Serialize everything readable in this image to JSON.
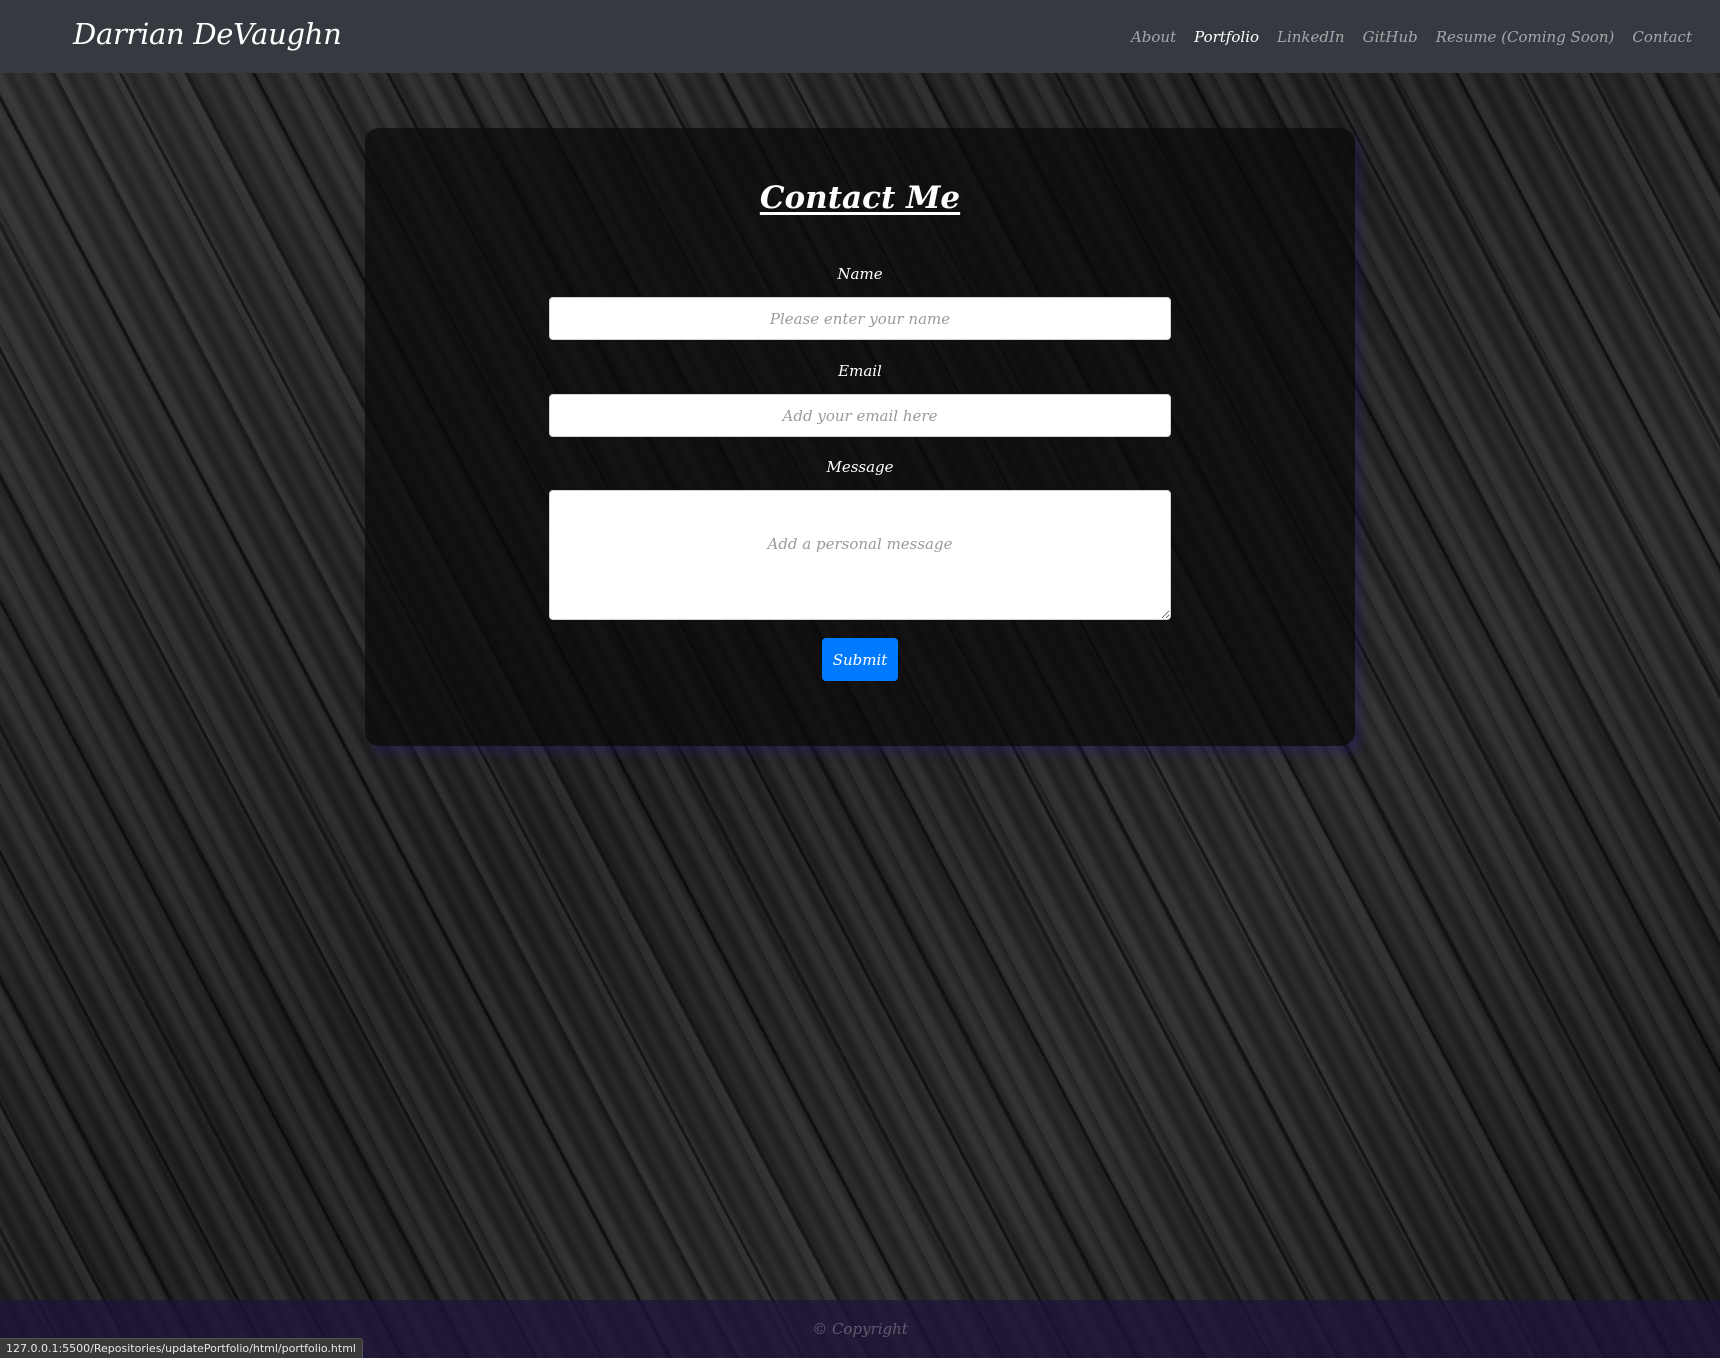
{
  "navbar": {
    "brand": "Darrian DeVaughn",
    "links": [
      {
        "label": "About",
        "active": false
      },
      {
        "label": "Portfolio",
        "active": true
      },
      {
        "label": "LinkedIn",
        "active": false
      },
      {
        "label": "GitHub",
        "active": false
      },
      {
        "label": "Resume (Coming Soon)",
        "active": false
      },
      {
        "label": "Contact",
        "active": false
      }
    ]
  },
  "contact": {
    "title": "Contact Me",
    "name_label": "Name",
    "name_placeholder": "Please enter your name",
    "email_label": "Email",
    "email_placeholder": "Add your email here",
    "message_label": "Message",
    "message_placeholder": "Add a personal message",
    "submit_label": "Submit"
  },
  "footer": {
    "text": "© Copyright"
  },
  "status_bar": {
    "url": "127.0.0.1:5500/Repositories/updatePortfolio/html/portfolio.html"
  },
  "colors": {
    "navbar_bg": "#343a40",
    "submit_bg": "#007bff",
    "footer_tint": "#1e123c"
  }
}
